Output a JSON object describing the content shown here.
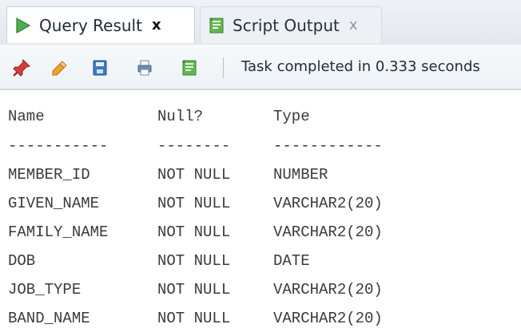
{
  "tabs": [
    {
      "label": "Query Result",
      "close_symbol": "x",
      "icon": "play-icon",
      "active": true
    },
    {
      "label": "Script Output",
      "close_symbol": "x",
      "icon": "script-output-icon",
      "active": false
    }
  ],
  "toolbar": {
    "buttons": [
      {
        "icon": "pin-icon"
      },
      {
        "icon": "eraser-icon"
      },
      {
        "icon": "save-icon"
      },
      {
        "icon": "print-icon"
      },
      {
        "icon": "script-output-icon"
      }
    ],
    "status_text": "Task completed in 0.333 seconds"
  },
  "output": {
    "headers": [
      "Name",
      "Null?",
      "Type"
    ],
    "dividers": [
      "-----------",
      "--------",
      "------------"
    ],
    "rows": [
      [
        "MEMBER_ID",
        "NOT NULL",
        "NUMBER"
      ],
      [
        "GIVEN_NAME",
        "NOT NULL",
        "VARCHAR2(20)"
      ],
      [
        "FAMILY_NAME",
        "NOT NULL",
        "VARCHAR2(20)"
      ],
      [
        "DOB",
        "NOT NULL",
        "DATE"
      ],
      [
        "JOB_TYPE",
        "NOT NULL",
        "VARCHAR2(20)"
      ],
      [
        "BAND_NAME",
        "NOT NULL",
        "VARCHAR2(20)"
      ]
    ]
  },
  "colors": {
    "play": "#4caf50",
    "pin": "#d83b3b",
    "eraser": "#f0a22e",
    "save": "#3b78c9",
    "print": "#6d8cab",
    "script": "#62b84d"
  }
}
